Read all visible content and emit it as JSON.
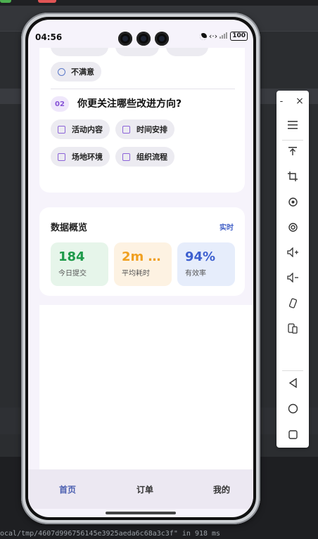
{
  "status_bar": {
    "time": "04:56",
    "signal_text": "‹·›",
    "battery": "100"
  },
  "survey": {
    "option_dissatisfied": "不满意",
    "q2_number": "02",
    "q2_text": "你更关注哪些改进方向?",
    "q2_options": [
      "活动内容",
      "时间安排",
      "场地环境",
      "组织流程"
    ]
  },
  "overview": {
    "title": "数据概览",
    "link": "实时",
    "stats": [
      {
        "value": "184",
        "label": "今日提交",
        "color": "#1e9a4a",
        "bg": "#e6f5ea"
      },
      {
        "value": "2m …",
        "label": "平均耗时",
        "color": "#f0a020",
        "bg": "#fdf2e2"
      },
      {
        "value": "94%",
        "label": "有效率",
        "color": "#3c5fcf",
        "bg": "#e6edfb"
      }
    ]
  },
  "tabbar": {
    "home": "首页",
    "orders": "订单",
    "profile": "我的"
  },
  "ide": {
    "status_line": "ocal/tmp/4607d996756145e3925aeda6c68a3c3f\" in 918 ms"
  },
  "toolbar": {
    "minimize": "-",
    "close": "×"
  },
  "colors": {
    "accent": "#4a5eb0",
    "purple": "#8652d6"
  }
}
